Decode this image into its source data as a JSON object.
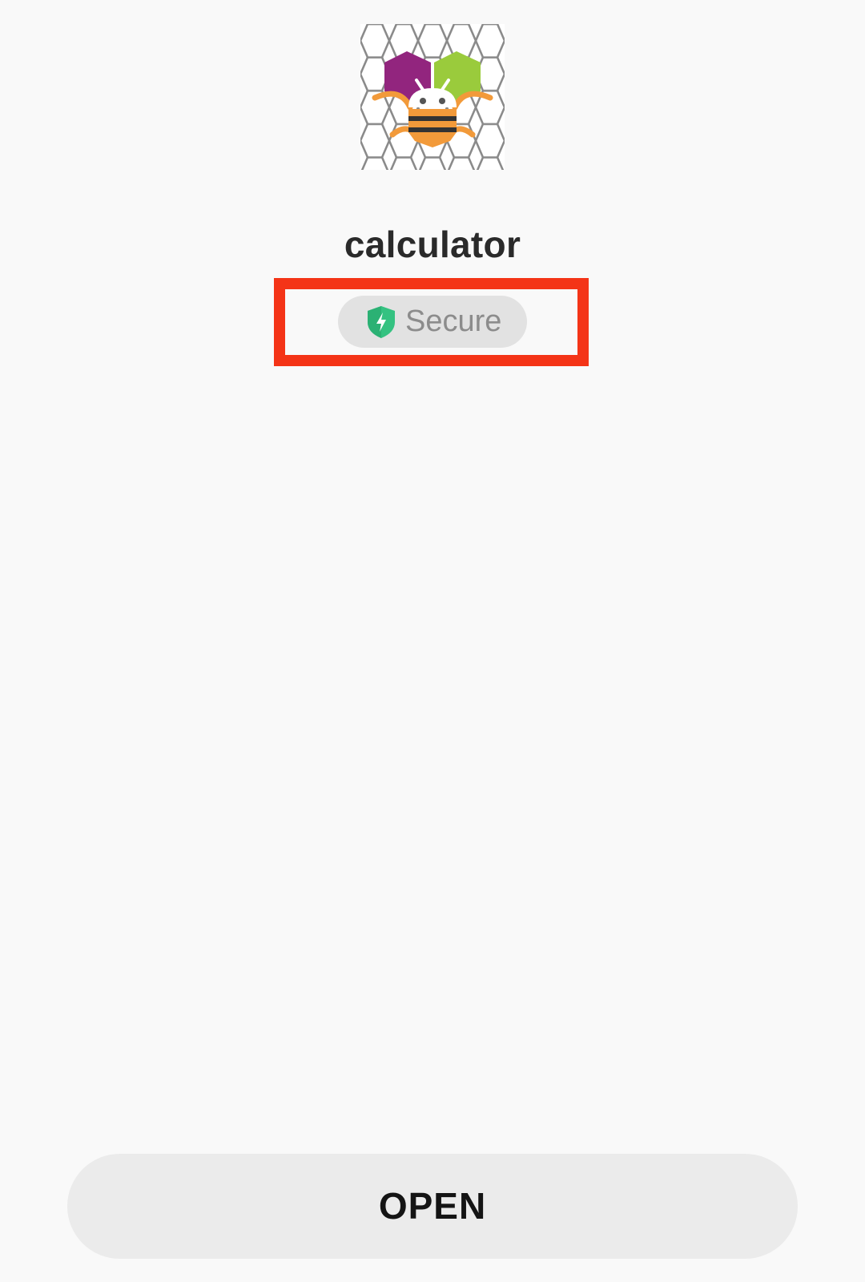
{
  "app": {
    "name": "calculator",
    "icon": "bee-honeycomb-app-icon"
  },
  "security": {
    "badge_label": "Secure",
    "badge_icon": "shield-bolt-icon",
    "badge_icon_color": "#34c281",
    "highlight_color": "#f43417"
  },
  "actions": {
    "open_label": "OPEN"
  }
}
